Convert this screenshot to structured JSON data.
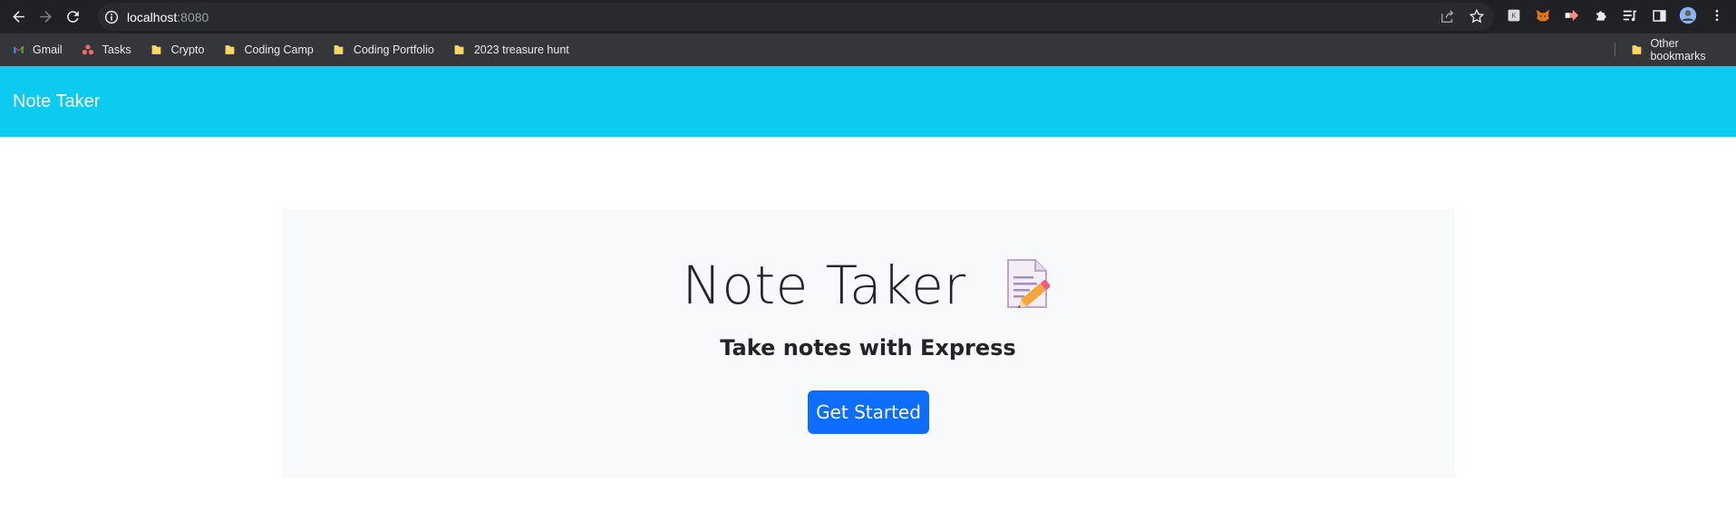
{
  "browser": {
    "url_host": "localhost",
    "url_port": ":8080",
    "icons": [
      "back-icon",
      "forward-icon",
      "reload-icon",
      "site-info-icon",
      "share-icon",
      "bookmark-star-icon",
      "extensions-icon",
      "side-panel-icon",
      "profile-avatar"
    ]
  },
  "bookmarks": {
    "items": [
      {
        "label": "Gmail",
        "icon": "gmail-icon"
      },
      {
        "label": "Tasks",
        "icon": "tasks-icon"
      },
      {
        "label": "Crypto",
        "icon": "folder-icon"
      },
      {
        "label": "Coding Camp",
        "icon": "folder-icon"
      },
      {
        "label": "Coding Portfolio",
        "icon": "folder-icon"
      },
      {
        "label": "2023 treasure hunt",
        "icon": "folder-icon"
      }
    ],
    "other": "Other bookmarks"
  },
  "navbar": {
    "brand": "Note Taker",
    "color": "#0dcaf0"
  },
  "hero": {
    "title": "Note Taker",
    "emoji": "memo-icon",
    "subtitle": "Take notes with Express",
    "button_label": "Get Started",
    "button_color": "#0d6efd"
  }
}
